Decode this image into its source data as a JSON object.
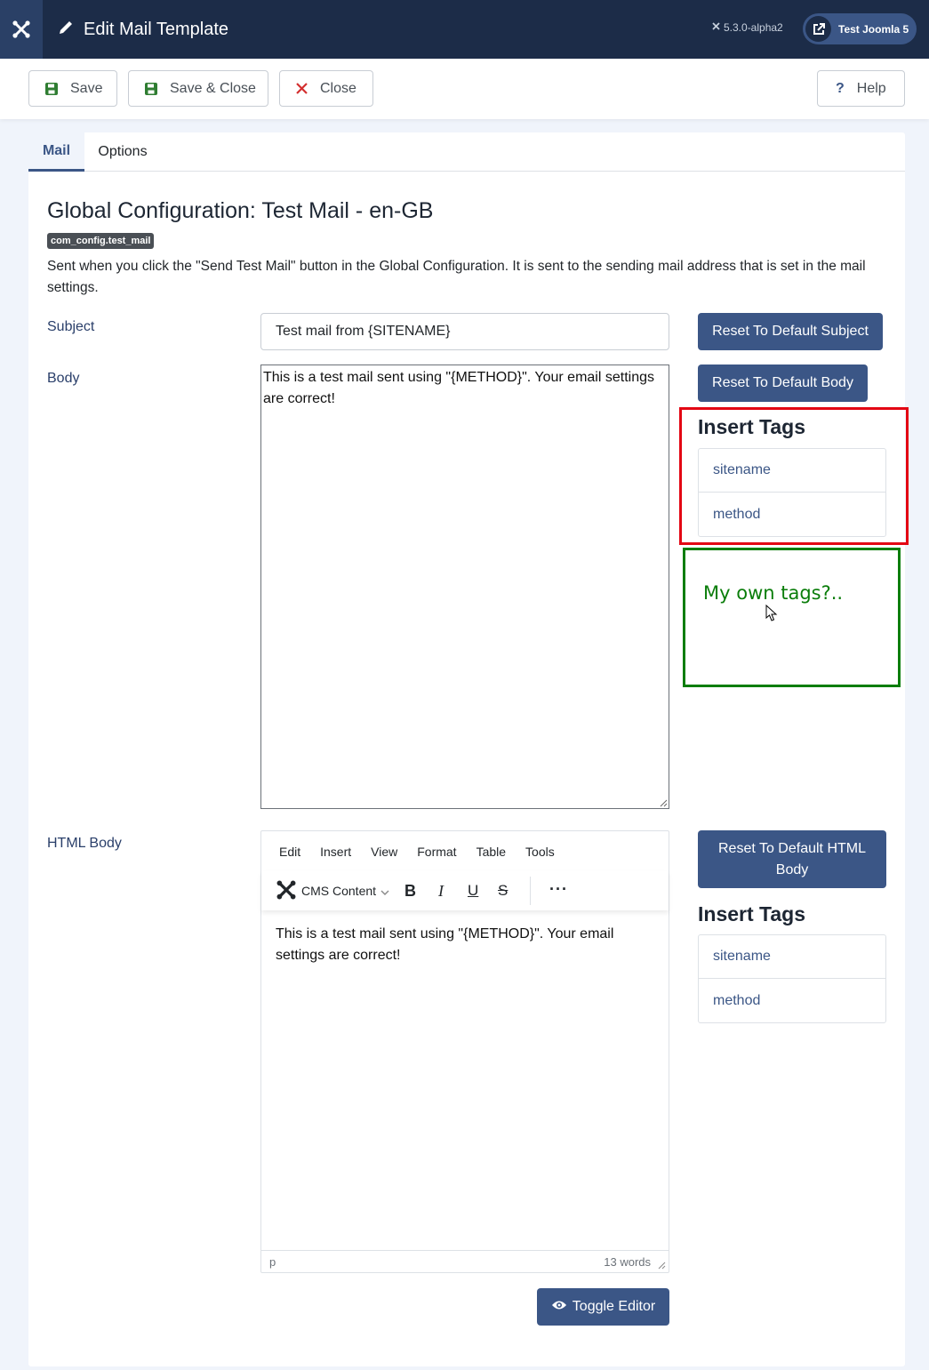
{
  "header": {
    "title": "Edit Mail Template",
    "version": "5.3.0-alpha2",
    "site_name": "Test Joomla 5"
  },
  "toolbar": {
    "save": "Save",
    "save_close": "Save & Close",
    "close": "Close",
    "help": "Help"
  },
  "tabs": [
    {
      "label": "Mail",
      "active": true
    },
    {
      "label": "Options",
      "active": false
    }
  ],
  "form": {
    "heading": "Global Configuration: Test Mail - en-GB",
    "key": "com_config.test_mail",
    "description": "Sent when you click the \"Send Test Mail\" button in the Global Configuration. It is sent to the sending mail address that is set in the mail settings.",
    "subject_label": "Subject",
    "subject_value": "Test mail from {SITENAME}",
    "body_label": "Body",
    "body_value": "This is a test mail sent using \"{METHOD}\". Your email settings are correct!",
    "html_body_label": "HTML Body",
    "reset_subject": "Reset To Default Subject",
    "reset_body": "Reset To Default Body",
    "reset_html_body": "Reset To Default HTML Body",
    "insert_tags_title": "Insert Tags",
    "tags": [
      "sitename",
      "method"
    ],
    "html_tags": [
      "sitename",
      "method"
    ],
    "toggle_editor": "Toggle Editor"
  },
  "editor": {
    "menu": [
      "Edit",
      "Insert",
      "View",
      "Format",
      "Table",
      "Tools"
    ],
    "cms_content": "CMS Content",
    "content": "This is a test mail sent using \"{METHOD}\". Your email settings are correct!",
    "status_path": "p",
    "word_count": "13 words"
  },
  "annotation": {
    "green_note": "My own tags?.."
  },
  "colors": {
    "header_bg": "#1c2c48",
    "primary": "#3b5686",
    "annotation_red": "#e30613",
    "annotation_green": "#0a7d0a"
  }
}
